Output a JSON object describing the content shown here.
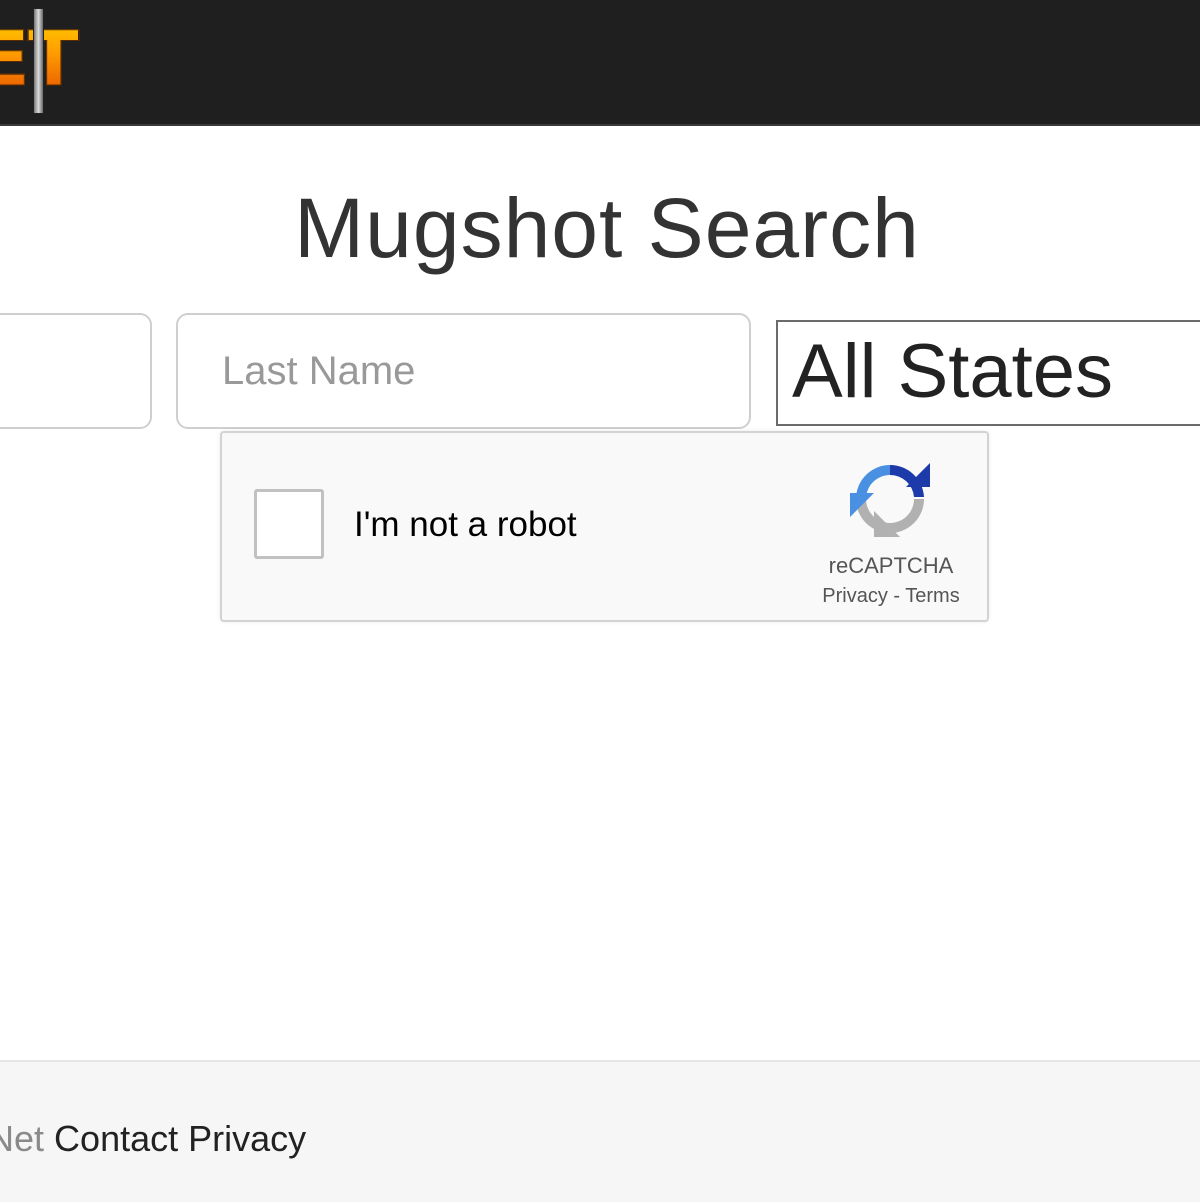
{
  "header": {
    "logo_text": "ET",
    "logo_name": "site-logo"
  },
  "main": {
    "title": "Mugshot Search",
    "first_name_placeholder": "",
    "last_name_placeholder": "Last Name",
    "state_select_value": "All States"
  },
  "captcha": {
    "label": "I'm not a robot",
    "brand": "reCAPTCHA",
    "privacy": "Privacy",
    "separator": " - ",
    "terms": "Terms",
    "colors": {
      "blue_dark": "#1c3aa9",
      "blue_light": "#4a90e2",
      "gray": "#b1b1b1"
    }
  },
  "footer": {
    "brand_partial": "Net",
    "contact": "Contact",
    "privacy": "Privacy"
  },
  "colors": {
    "topbar_bg": "#1f1f1f",
    "footer_bg": "#f6f6f6",
    "title_text": "#333333",
    "placeholder": "#999999"
  }
}
